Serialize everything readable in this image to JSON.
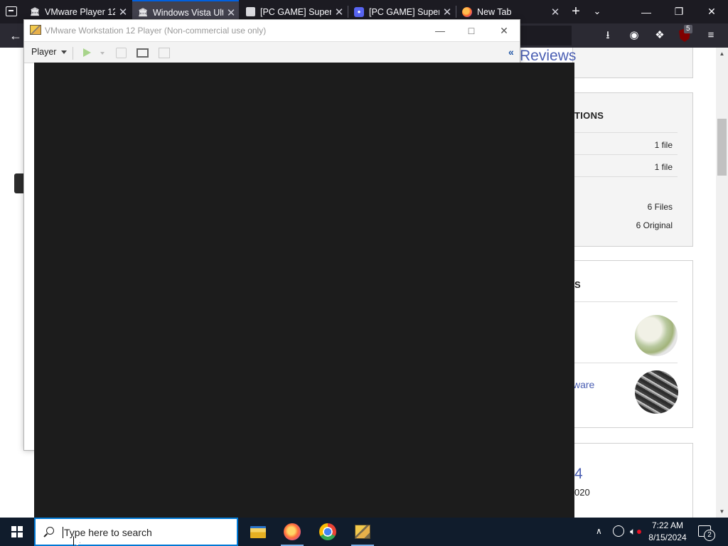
{
  "firefox": {
    "tabs": [
      {
        "title": "VMware Player 12",
        "favicon": "internet-archive-icon",
        "active": false
      },
      {
        "title": "Windows Vista Ult",
        "favicon": "internet-archive-icon",
        "active": true
      },
      {
        "title": "[PC GAME] Super",
        "favicon": "document-icon",
        "active": false
      },
      {
        "title": "[PC GAME] Super",
        "favicon": "discord-icon",
        "active": false
      },
      {
        "title": "New Tab",
        "favicon": "firefox-icon",
        "active": false
      }
    ],
    "addon_badge": "5"
  },
  "page": {
    "reviews_heading": "Reviews",
    "description_heading": "TIONS",
    "rows": [
      {
        "value": "1 file"
      },
      {
        "value": "1 file"
      },
      {
        "value": "6 Files"
      },
      {
        "value": "6 Original"
      }
    ],
    "related_heading": "S",
    "related_link": "ware",
    "uploader_number": "4",
    "uploader_year": "020"
  },
  "vmware": {
    "title": "VMware Workstation 12 Player (Non-commercial use only)",
    "player_menu": "Player",
    "collapse_glyph": "«"
  },
  "taskbar": {
    "search_placeholder": "Type here to search",
    "time": "7:22 AM",
    "date": "8/15/2024",
    "notification_count": "2"
  },
  "colors": {
    "firefox_tabbar": "#1c1b22",
    "vm_screen": "#1c1c1c",
    "taskbar": "#101c2c",
    "link": "#4b5fb3"
  }
}
